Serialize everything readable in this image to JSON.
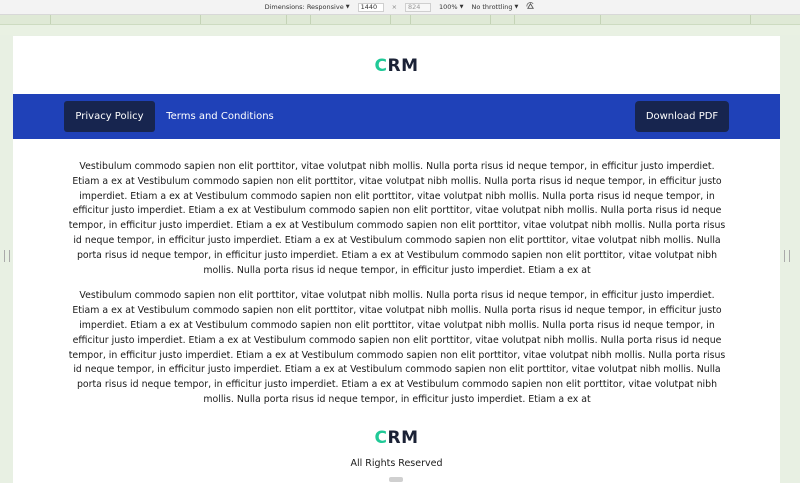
{
  "devtools": {
    "dimensions_label": "Dimensions: Responsive",
    "width_value": "1440",
    "times": "×",
    "height_value": "824",
    "zoom_label": "100%",
    "throttling_label": "No throttling"
  },
  "header": {
    "logo_first": "C",
    "logo_rest": "RM",
    "accent_color": "#20c997"
  },
  "nav": {
    "items": [
      {
        "label": "Privacy Policy",
        "active": true
      },
      {
        "label": "Terms and Conditions",
        "active": false
      }
    ],
    "download_label": "Download PDF",
    "bar_color": "#1f41b8",
    "button_color": "#17254f"
  },
  "content": {
    "paragraphs": [
      "Vestibulum commodo sapien non elit porttitor, vitae volutpat nibh mollis. Nulla porta risus id neque tempor, in efficitur justo imperdiet. Etiam a ex at Vestibulum commodo sapien non elit porttitor, vitae volutpat nibh mollis. Nulla porta risus id neque tempor, in efficitur justo imperdiet. Etiam a ex at Vestibulum commodo sapien non elit porttitor, vitae volutpat nibh mollis. Nulla porta risus id neque tempor, in efficitur justo imperdiet. Etiam a ex at Vestibulum commodo sapien non elit porttitor, vitae volutpat nibh mollis. Nulla porta risus id neque tempor, in efficitur justo imperdiet. Etiam a ex at Vestibulum commodo sapien non elit porttitor, vitae volutpat nibh mollis. Nulla porta risus id neque tempor, in efficitur justo imperdiet. Etiam a ex at Vestibulum commodo sapien non elit porttitor, vitae volutpat nibh mollis. Nulla porta risus id neque tempor, in efficitur justo imperdiet. Etiam a ex at Vestibulum commodo sapien non elit porttitor, vitae volutpat nibh mollis. Nulla porta risus id neque tempor, in efficitur justo imperdiet. Etiam a ex at",
      "Vestibulum commodo sapien non elit porttitor, vitae volutpat nibh mollis. Nulla porta risus id neque tempor, in efficitur justo imperdiet. Etiam a ex at Vestibulum commodo sapien non elit porttitor, vitae volutpat nibh mollis. Nulla porta risus id neque tempor, in efficitur justo imperdiet. Etiam a ex at Vestibulum commodo sapien non elit porttitor, vitae volutpat nibh mollis. Nulla porta risus id neque tempor, in efficitur justo imperdiet. Etiam a ex at Vestibulum commodo sapien non elit porttitor, vitae volutpat nibh mollis. Nulla porta risus id neque tempor, in efficitur justo imperdiet. Etiam a ex at Vestibulum commodo sapien non elit porttitor, vitae volutpat nibh mollis. Nulla porta risus id neque tempor, in efficitur justo imperdiet. Etiam a ex at Vestibulum commodo sapien non elit porttitor, vitae volutpat nibh mollis. Nulla porta risus id neque tempor, in efficitur justo imperdiet. Etiam a ex at Vestibulum commodo sapien non elit porttitor, vitae volutpat nibh mollis. Nulla porta risus id neque tempor, in efficitur justo imperdiet. Etiam a ex at"
    ]
  },
  "footer": {
    "logo_first": "C",
    "logo_rest": "RM",
    "copyright": "All Rights Reserved"
  }
}
